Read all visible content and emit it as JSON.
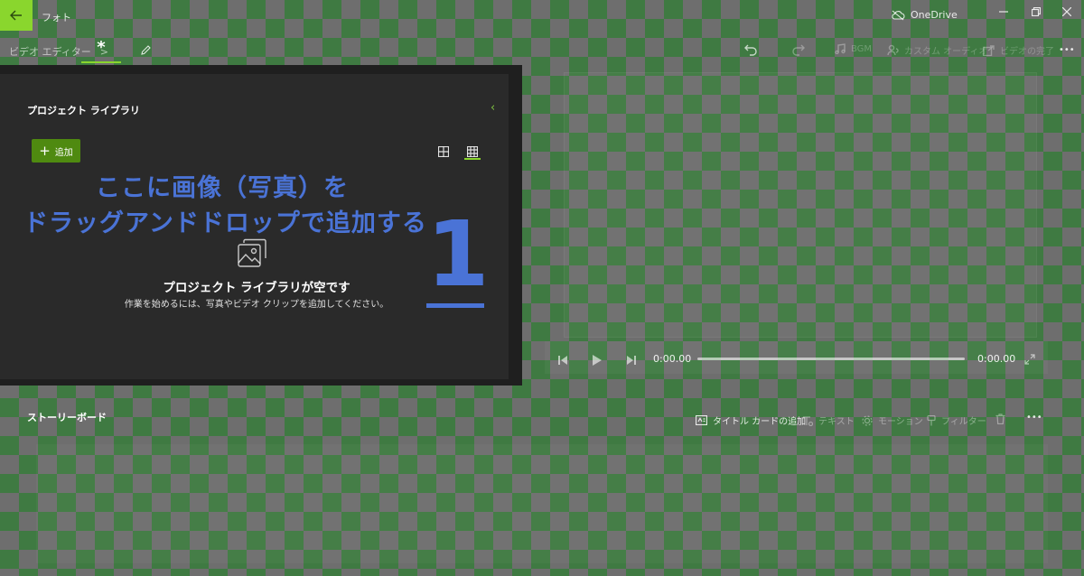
{
  "titlebar": {
    "app_title": "フォト",
    "onedrive_label": "OneDrive"
  },
  "toolbar": {
    "breadcrumb_root": "ビデオ エディター",
    "breadcrumb_separator": ">",
    "project_name": "*",
    "bgm_label": "BGM",
    "custom_audio_label": "カスタム オーディオ",
    "finish_video_label": "ビデオの完了",
    "more_label": "•••"
  },
  "library": {
    "title": "プロジェクト ライブラリ",
    "collapse_glyph": "‹",
    "add_label": "追加",
    "add_glyph": "+",
    "empty_title": "プロジェクト ライブラリが空です",
    "empty_subtitle": "作業を始めるには、写真やビデオ クリップを追加してください。"
  },
  "overlay": {
    "line1": "ここに画像（写真）を",
    "line2": "ドラッグアンドドロップで追加する",
    "step_number": "1"
  },
  "player": {
    "time_current": "0:00.00",
    "time_total": "0:00.00"
  },
  "storyboard": {
    "label": "ストーリーボード",
    "add_title_card_label": "タイトル カードの追加",
    "text_label": "テキスト",
    "motion_label": "モーション",
    "filter_label": "フィルター",
    "more_label": "•••"
  },
  "colors": {
    "accent_green": "#8ad62d",
    "add_button_green": "#4f8a10",
    "overlay_blue": "#4a73d6",
    "panel_bg": "#2a2a2a"
  }
}
